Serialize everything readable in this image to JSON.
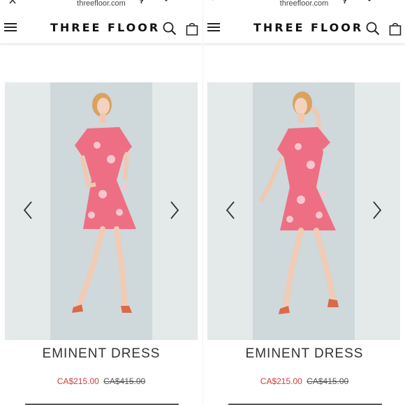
{
  "browser": {
    "url": "threefloor.com"
  },
  "header": {
    "brand": "THREE FLOOR"
  },
  "icons": {
    "menu": "hamburger-menu-icon",
    "search": "search-icon",
    "bag": "shopping-bag-icon",
    "prev": "chevron-left-icon",
    "next": "chevron-right-icon"
  },
  "colors": {
    "accent_sale": "#d23b3b",
    "dress_pink": "#ee6f84",
    "backdrop": "#cfd8da"
  },
  "panels": [
    {
      "product": {
        "title": "EMINENT DRESS",
        "sale_price": "CA$215.00",
        "original_price": "CA$415.00"
      }
    },
    {
      "product": {
        "title": "EMINENT DRESS",
        "sale_price": "CA$215.00",
        "original_price": "CA$415.00"
      }
    }
  ]
}
